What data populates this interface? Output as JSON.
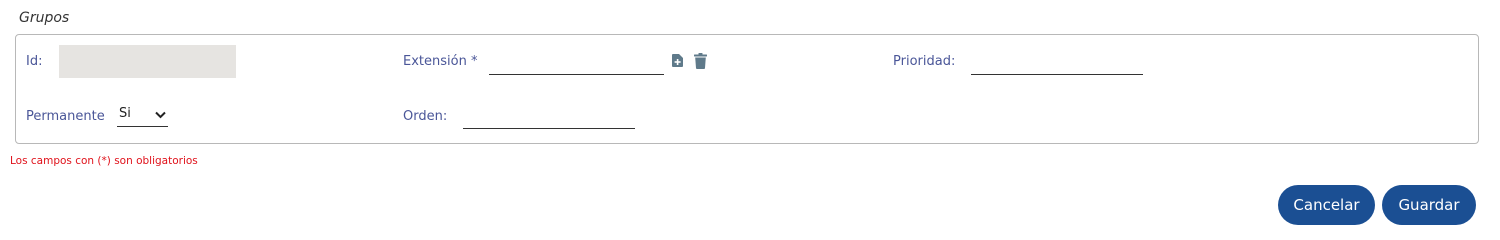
{
  "section": {
    "title": "Grupos"
  },
  "form": {
    "id_label": "Id:",
    "id_value": "",
    "extension_label": "Extensión *",
    "extension_value": "",
    "prioridad_label": "Prioridad:",
    "prioridad_value": "",
    "permanente_label": "Permanente",
    "permanente_selected": "Si",
    "orden_label": "Orden:",
    "orden_value": ""
  },
  "icons": {
    "add": "file-add-icon",
    "delete": "trash-icon",
    "dropdown": "chevron-down-icon"
  },
  "note": {
    "required_text": "Los campos con (*) son obligatorios"
  },
  "actions": {
    "cancel_label": "Cancelar",
    "save_label": "Guardar"
  },
  "colors": {
    "label": "#4a5698",
    "button": "#1b4f93",
    "icon": "#5f7a8a",
    "required": "#e0121b",
    "disabled_input": "#e6e4e1"
  }
}
